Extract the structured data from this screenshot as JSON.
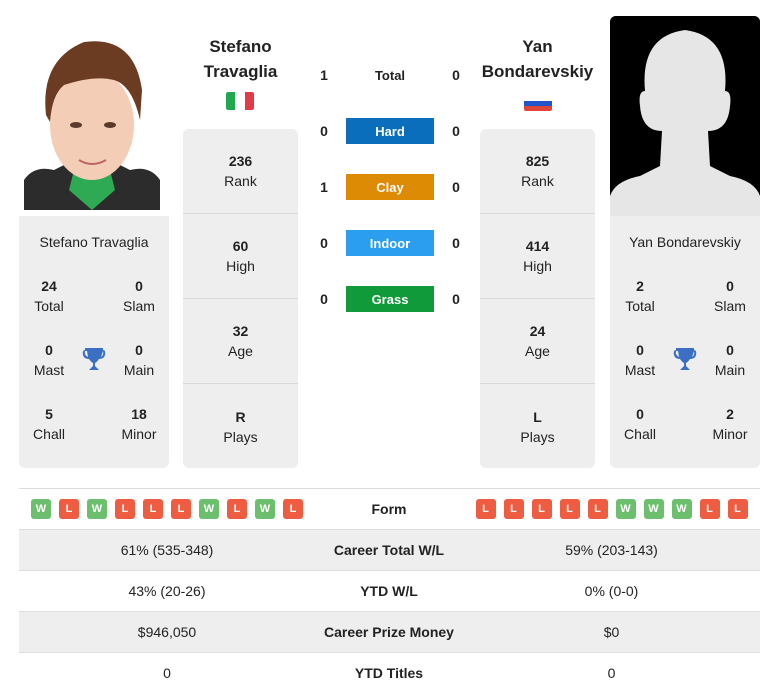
{
  "players": {
    "left": {
      "name_line1": "Stefano",
      "name_line2": "Travaglia",
      "full_name": "Stefano Travaglia",
      "country": "Italy",
      "flag_colors": [
        "#009246",
        "#ffffff",
        "#ce2b37"
      ],
      "rank": {
        "value": "236",
        "label": "Rank"
      },
      "high": {
        "value": "60",
        "label": "High"
      },
      "age": {
        "value": "32",
        "label": "Age"
      },
      "plays": {
        "value": "R",
        "label": "Plays"
      },
      "titles": {
        "total": {
          "value": "24",
          "label": "Total"
        },
        "slam": {
          "value": "0",
          "label": "Slam"
        },
        "mast": {
          "value": "0",
          "label": "Mast"
        },
        "main": {
          "value": "0",
          "label": "Main"
        },
        "chall": {
          "value": "5",
          "label": "Chall"
        },
        "minor": {
          "value": "18",
          "label": "Minor"
        }
      },
      "form": [
        "W",
        "L",
        "W",
        "L",
        "L",
        "L",
        "W",
        "L",
        "W",
        "L"
      ]
    },
    "right": {
      "name_line1": "Yan",
      "name_line2": "Bondarevskiy",
      "full_name": "Yan Bondarevskiy",
      "country": "Russia",
      "flag_colors": [
        "#ffffff",
        "#0039a6",
        "#d52b1e"
      ],
      "rank": {
        "value": "825",
        "label": "Rank"
      },
      "high": {
        "value": "414",
        "label": "High"
      },
      "age": {
        "value": "24",
        "label": "Age"
      },
      "plays": {
        "value": "L",
        "label": "Plays"
      },
      "titles": {
        "total": {
          "value": "2",
          "label": "Total"
        },
        "slam": {
          "value": "0",
          "label": "Slam"
        },
        "mast": {
          "value": "0",
          "label": "Mast"
        },
        "main": {
          "value": "0",
          "label": "Main"
        },
        "chall": {
          "value": "0",
          "label": "Chall"
        },
        "minor": {
          "value": "2",
          "label": "Minor"
        }
      },
      "form": [
        "L",
        "L",
        "L",
        "L",
        "L",
        "W",
        "W",
        "W",
        "L",
        "L"
      ]
    }
  },
  "h2h": [
    {
      "label": "Total",
      "left": "1",
      "right": "0",
      "color": ""
    },
    {
      "label": "Hard",
      "left": "0",
      "right": "0",
      "color": "#0a6ebd"
    },
    {
      "label": "Clay",
      "left": "1",
      "right": "0",
      "color": "#dd8a04"
    },
    {
      "label": "Indoor",
      "left": "0",
      "right": "0",
      "color": "#2b9ef0"
    },
    {
      "label": "Grass",
      "left": "0",
      "right": "0",
      "color": "#109a3a"
    }
  ],
  "table": {
    "form_label": "Form",
    "rows": [
      {
        "label": "Career Total W/L",
        "left": "61% (535-348)",
        "right": "59% (203-143)"
      },
      {
        "label": "YTD W/L",
        "left": "43% (20-26)",
        "right": "0% (0-0)"
      },
      {
        "label": "Career Prize Money",
        "left": "$946,050",
        "right": "$0"
      },
      {
        "label": "YTD Titles",
        "left": "0",
        "right": "0"
      }
    ]
  },
  "colors": {
    "win": "#6cbf6c",
    "loss": "#ee5c42",
    "trophy": "#3b6fc4",
    "card_bg": "#eeeeee"
  }
}
